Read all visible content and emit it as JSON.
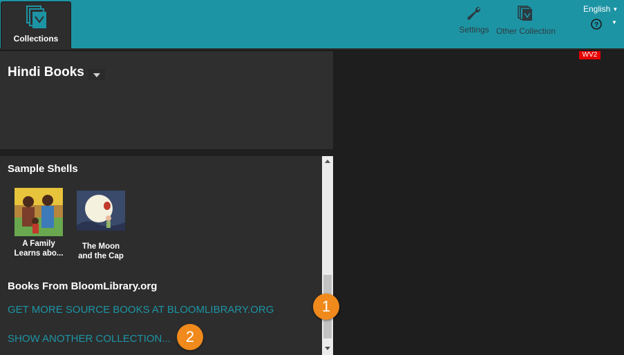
{
  "topbar": {
    "collections_label": "Collections",
    "settings_label": "Settings",
    "other_collection_label": "Other Collection",
    "language": "English"
  },
  "collection": {
    "title": "Hindi Books"
  },
  "sample_shells": {
    "title": "Sample Shells",
    "books": [
      {
        "caption_line1": "A Family",
        "caption_line2": "Learns abo...",
        "icon": "family-book-thumbnail"
      },
      {
        "caption_line1": "The Moon",
        "caption_line2": "and the Cap",
        "icon": "moon-book-thumbnail"
      }
    ]
  },
  "bloomlibrary": {
    "title": "Books From BloomLibrary.org",
    "get_more_link": "GET MORE SOURCE BOOKS AT BLOOMLIBRARY.ORG",
    "show_another_link": "SHOW ANOTHER COLLECTION..."
  },
  "preview": {
    "badge": "WV2"
  },
  "callouts": [
    "1",
    "2"
  ],
  "colors": {
    "accent": "#1d94a4",
    "callout": "#f08a1c",
    "badge": "#e60000",
    "panel": "#2d2d2d"
  }
}
